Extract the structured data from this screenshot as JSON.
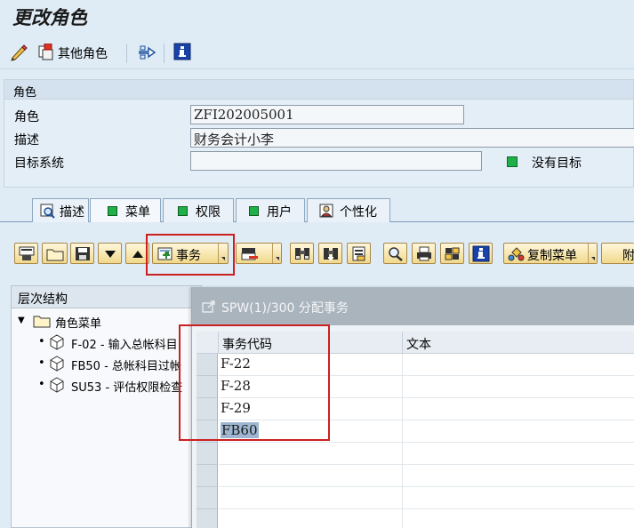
{
  "title": "更改角色",
  "app_toolbar": {
    "other_roles": "其他角色"
  },
  "role_group": {
    "header": "角色",
    "role_label": "角色",
    "role_value": "ZFI202005001",
    "desc_label": "描述",
    "desc_value": "财务会计小李",
    "target_label": "目标系统",
    "target_value": "",
    "no_target": "没有目标"
  },
  "tabs": [
    "描述",
    "菜单",
    "权限",
    "用户",
    "个性化"
  ],
  "toolbar": {
    "transaction": "事务",
    "copy_menu": "复制菜单",
    "attach": "附"
  },
  "tree": {
    "header": "层次结构",
    "root": "角色菜单",
    "nodes": [
      "F-02 - 输入总帐科目",
      "FB50 - 总帐科目过帐",
      "SU53 - 评估权限检查"
    ]
  },
  "dialog": {
    "title": "SPW(1)/300 分配事务",
    "col_code": "事务代码",
    "col_text": "文本",
    "rows": [
      "F-22",
      "F-28",
      "F-29",
      "FB60",
      "",
      "",
      "",
      ""
    ]
  },
  "colors": {
    "status_green": "#1fb04a",
    "highlight_red": "#cc1f1f"
  }
}
